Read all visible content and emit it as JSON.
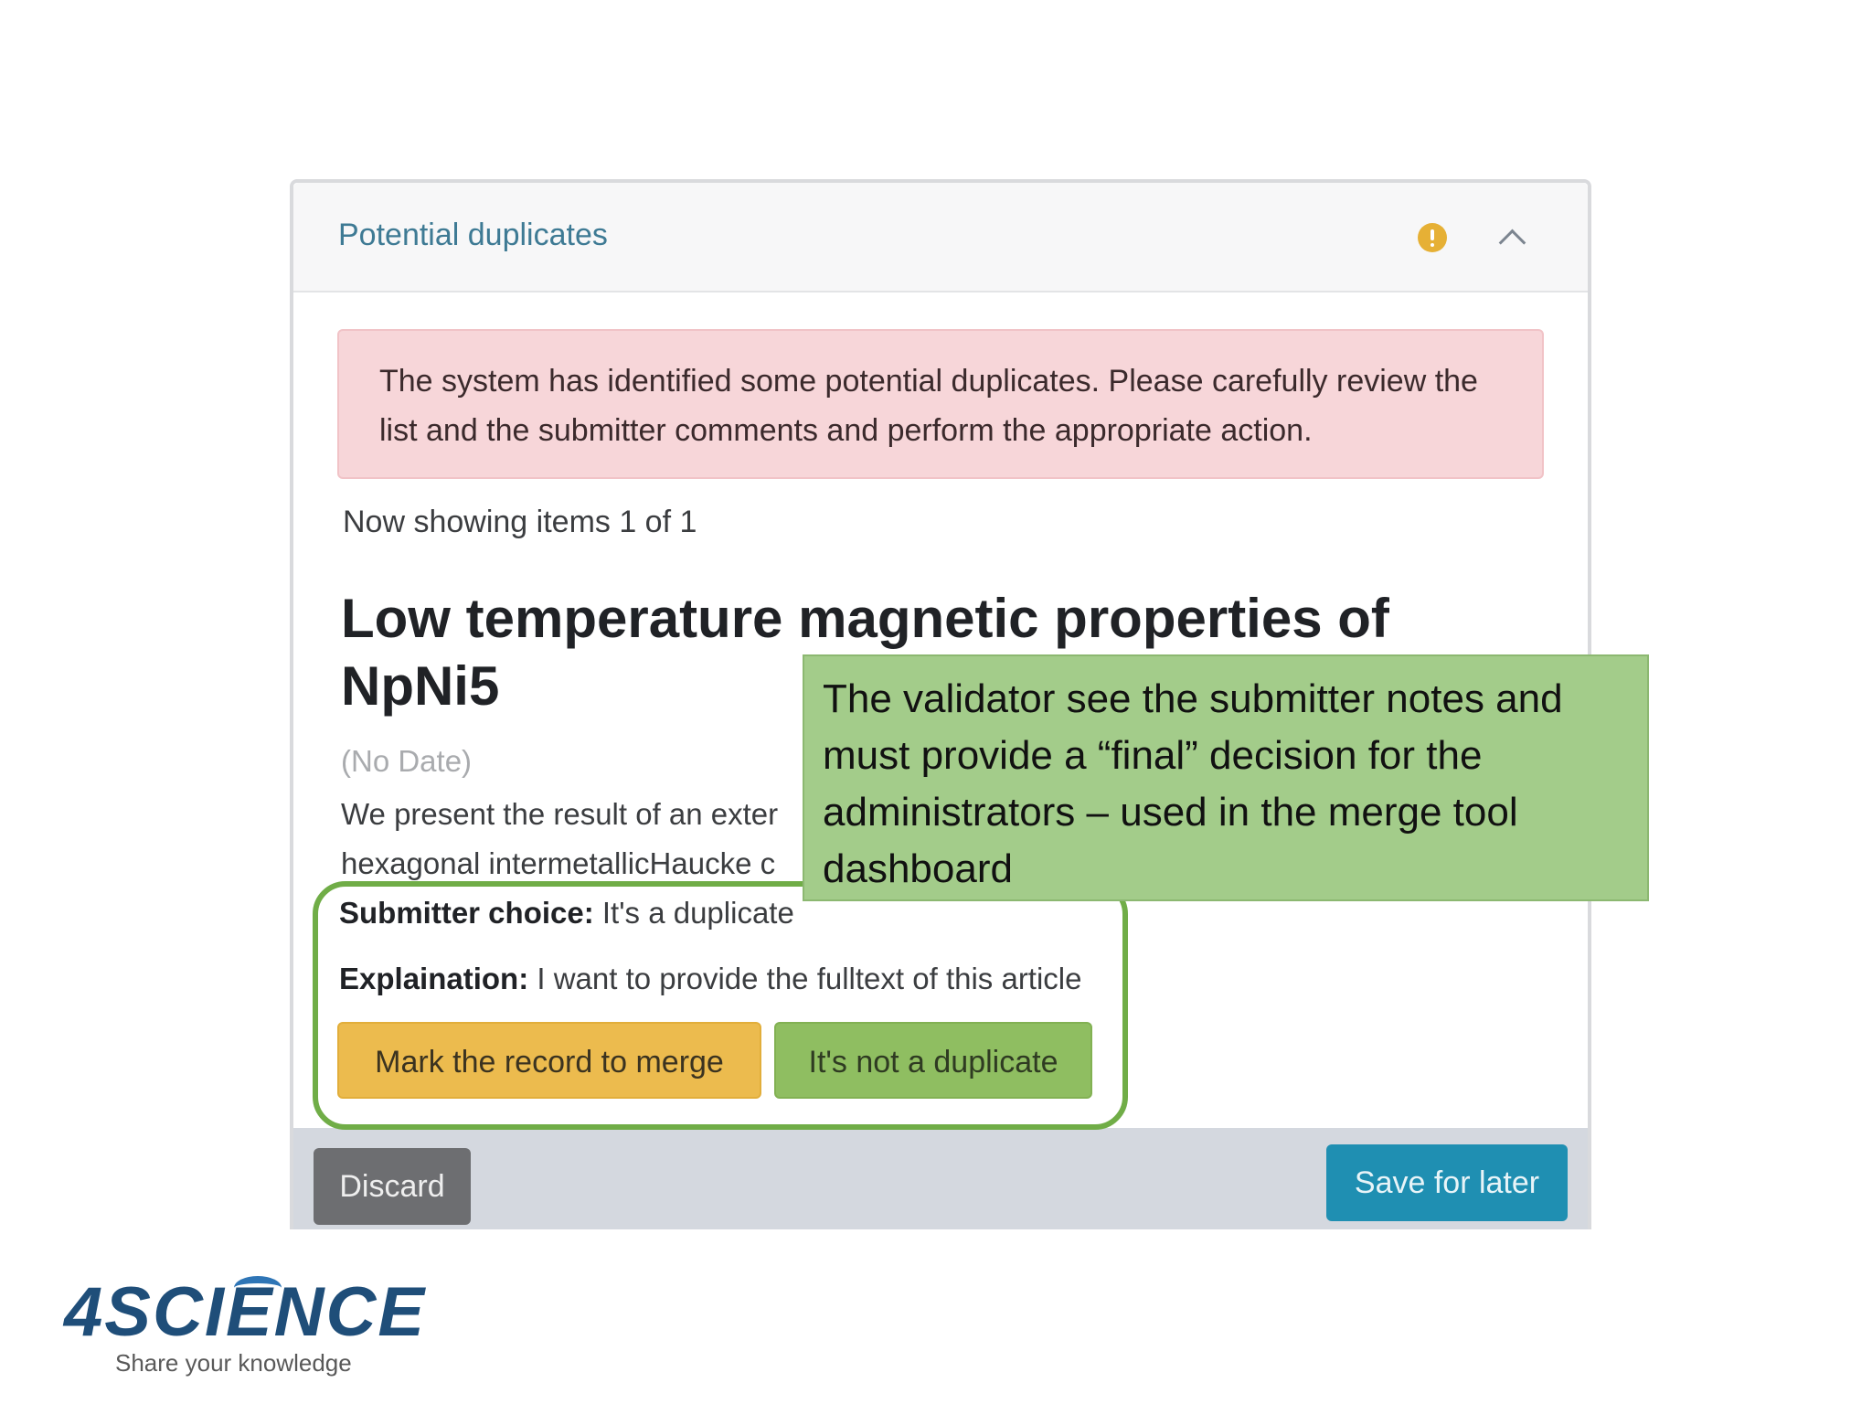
{
  "panel": {
    "title": "Potential duplicates",
    "warning_icon": "exclamation-circle-icon",
    "collapse_icon": "chevron-up-icon"
  },
  "alert": {
    "text": "The system has identified some potential duplicates. Please carefully review the list and the submitter comments and perform the appropriate action."
  },
  "pagination": {
    "text": "Now showing items 1 of 1"
  },
  "item": {
    "title": "Low temperature magnetic properties of NpNi5",
    "date": "(No Date)",
    "abstract_line1": "We present the result of an exter",
    "abstract_line2": "hexagonal intermetallicHaucke c"
  },
  "decision": {
    "submitter_label": "Submitter choice:",
    "submitter_value": "It's a duplicate",
    "explanation_label": "Explaination:",
    "explanation_value": "I want to provide the fulltext of this article"
  },
  "actions": {
    "merge_label": "Mark the record to merge",
    "not_duplicate_label": "It's not a duplicate",
    "discard_label": "Discard",
    "save_label": "Save for later"
  },
  "callout": {
    "text": "The validator see the submitter notes and must provide a “final” decision for the administrators – used in the merge tool dashboard"
  },
  "logo": {
    "name": "4SCIENCE",
    "tagline": "Share your knowledge"
  },
  "colors": {
    "title_blue": "#3e7a94",
    "alert_bg": "#f7d6d9",
    "merge_btn": "#ecbb4e",
    "not_dup_btn": "#8fbe61",
    "save_btn": "#1f8fb2",
    "discard_btn": "#6d6e71",
    "highlight_border": "#70ad47",
    "callout_bg": "#a3cc8a"
  }
}
